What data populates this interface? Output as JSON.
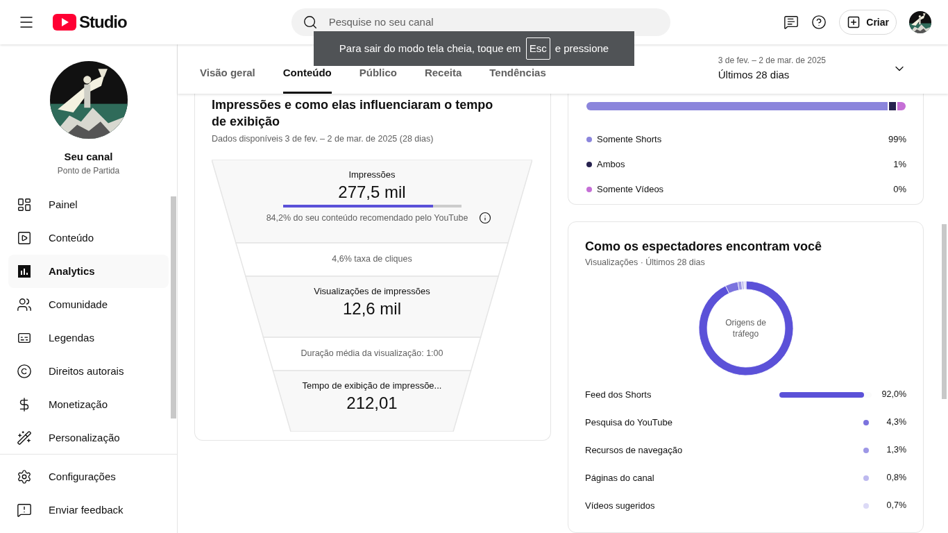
{
  "header": {
    "logo_text": "Studio",
    "search": {
      "placeholder": "Pesquise no seu canal"
    },
    "create_button": "Criar"
  },
  "toast": {
    "before": "Para sair do modo tela cheia, toque em",
    "key": "Esc",
    "after": "e pressione"
  },
  "sidebar": {
    "channel_title": "Seu canal",
    "channel_name": "Ponto de Partida",
    "items": [
      {
        "label": "Painel",
        "selected": false
      },
      {
        "label": "Conteúdo",
        "selected": false
      },
      {
        "label": "Analytics",
        "selected": true
      },
      {
        "label": "Comunidade",
        "selected": false
      },
      {
        "label": "Legendas",
        "selected": false
      },
      {
        "label": "Direitos autorais",
        "selected": false
      },
      {
        "label": "Monetização",
        "selected": false
      },
      {
        "label": "Personalização",
        "selected": false
      }
    ],
    "footer_items": [
      {
        "label": "Configurações"
      },
      {
        "label": "Enviar feedback"
      }
    ]
  },
  "tabs": [
    {
      "label": "Visão geral",
      "selected": false
    },
    {
      "label": "Conteúdo",
      "selected": true
    },
    {
      "label": "Público",
      "selected": false
    },
    {
      "label": "Receita",
      "selected": false
    },
    {
      "label": "Tendências",
      "selected": false
    }
  ],
  "date_range": {
    "range": "3 de fev. – 2 de mar. de 2025",
    "label": "Últimos 28 dias"
  },
  "funnel_card": {
    "title": "Impressões e como elas influenciaram o tempo de exibição",
    "subtitle": "Dados disponíveis 3 de fev. – 2 de mar. de 2025 (28 dias)",
    "stages": [
      {
        "kind": "metric",
        "label": "Impressões",
        "value": "277,5 mil",
        "level": 0.842,
        "note": "84,2% do seu conteúdo recomendado pelo YouTube"
      },
      {
        "kind": "rate",
        "text": "4,6% taxa de cliques"
      },
      {
        "kind": "metric",
        "label": "Visualizações de impressões",
        "value": "12,6 mil"
      },
      {
        "kind": "rate",
        "text": "Duração média da visualização: 1:00"
      },
      {
        "kind": "metric",
        "label": "Tempo de exibição de impressõe...",
        "value": "212,01"
      }
    ]
  },
  "content_type_card": {
    "segments": [
      {
        "label": "Somente Shorts",
        "value": "99%",
        "color": "#8b85dc"
      },
      {
        "label": "Ambos",
        "value": "1%",
        "color": "#27224f"
      },
      {
        "label": "Somente Vídeos",
        "value": "0%",
        "color": "#c56fd6"
      }
    ]
  },
  "traffic_card": {
    "title": "Como os espectadores encontram você",
    "subtitle": "Visualizações · Últimos 28 dias",
    "chart_data": {
      "type": "donut",
      "title": "Origens de tráfego",
      "categories": [
        "Feed dos Shorts",
        "Pesquisa do YouTube",
        "Recursos de navegação",
        "Páginas do canal",
        "Vídeos sugeridos"
      ],
      "values": [
        92.0,
        4.3,
        1.3,
        0.8,
        0.7
      ],
      "colors": [
        "#5b51d8",
        "#7b73de",
        "#9d97e6",
        "#bdb9ef",
        "#dcdaf6"
      ]
    },
    "sources": [
      {
        "kind": "bar",
        "value": "92,0%",
        "color": "#5b51d8",
        "level": 0.92
      },
      {
        "kind": "dot",
        "value": "4,3%",
        "color": "#7b73de"
      },
      {
        "kind": "dot",
        "value": "1,3%",
        "color": "#9d97e6"
      },
      {
        "kind": "dot",
        "value": "0,8%",
        "color": "#bdb9ef"
      },
      {
        "kind": "dot",
        "value": "0,7%",
        "color": "#dcdaf6"
      }
    ]
  }
}
